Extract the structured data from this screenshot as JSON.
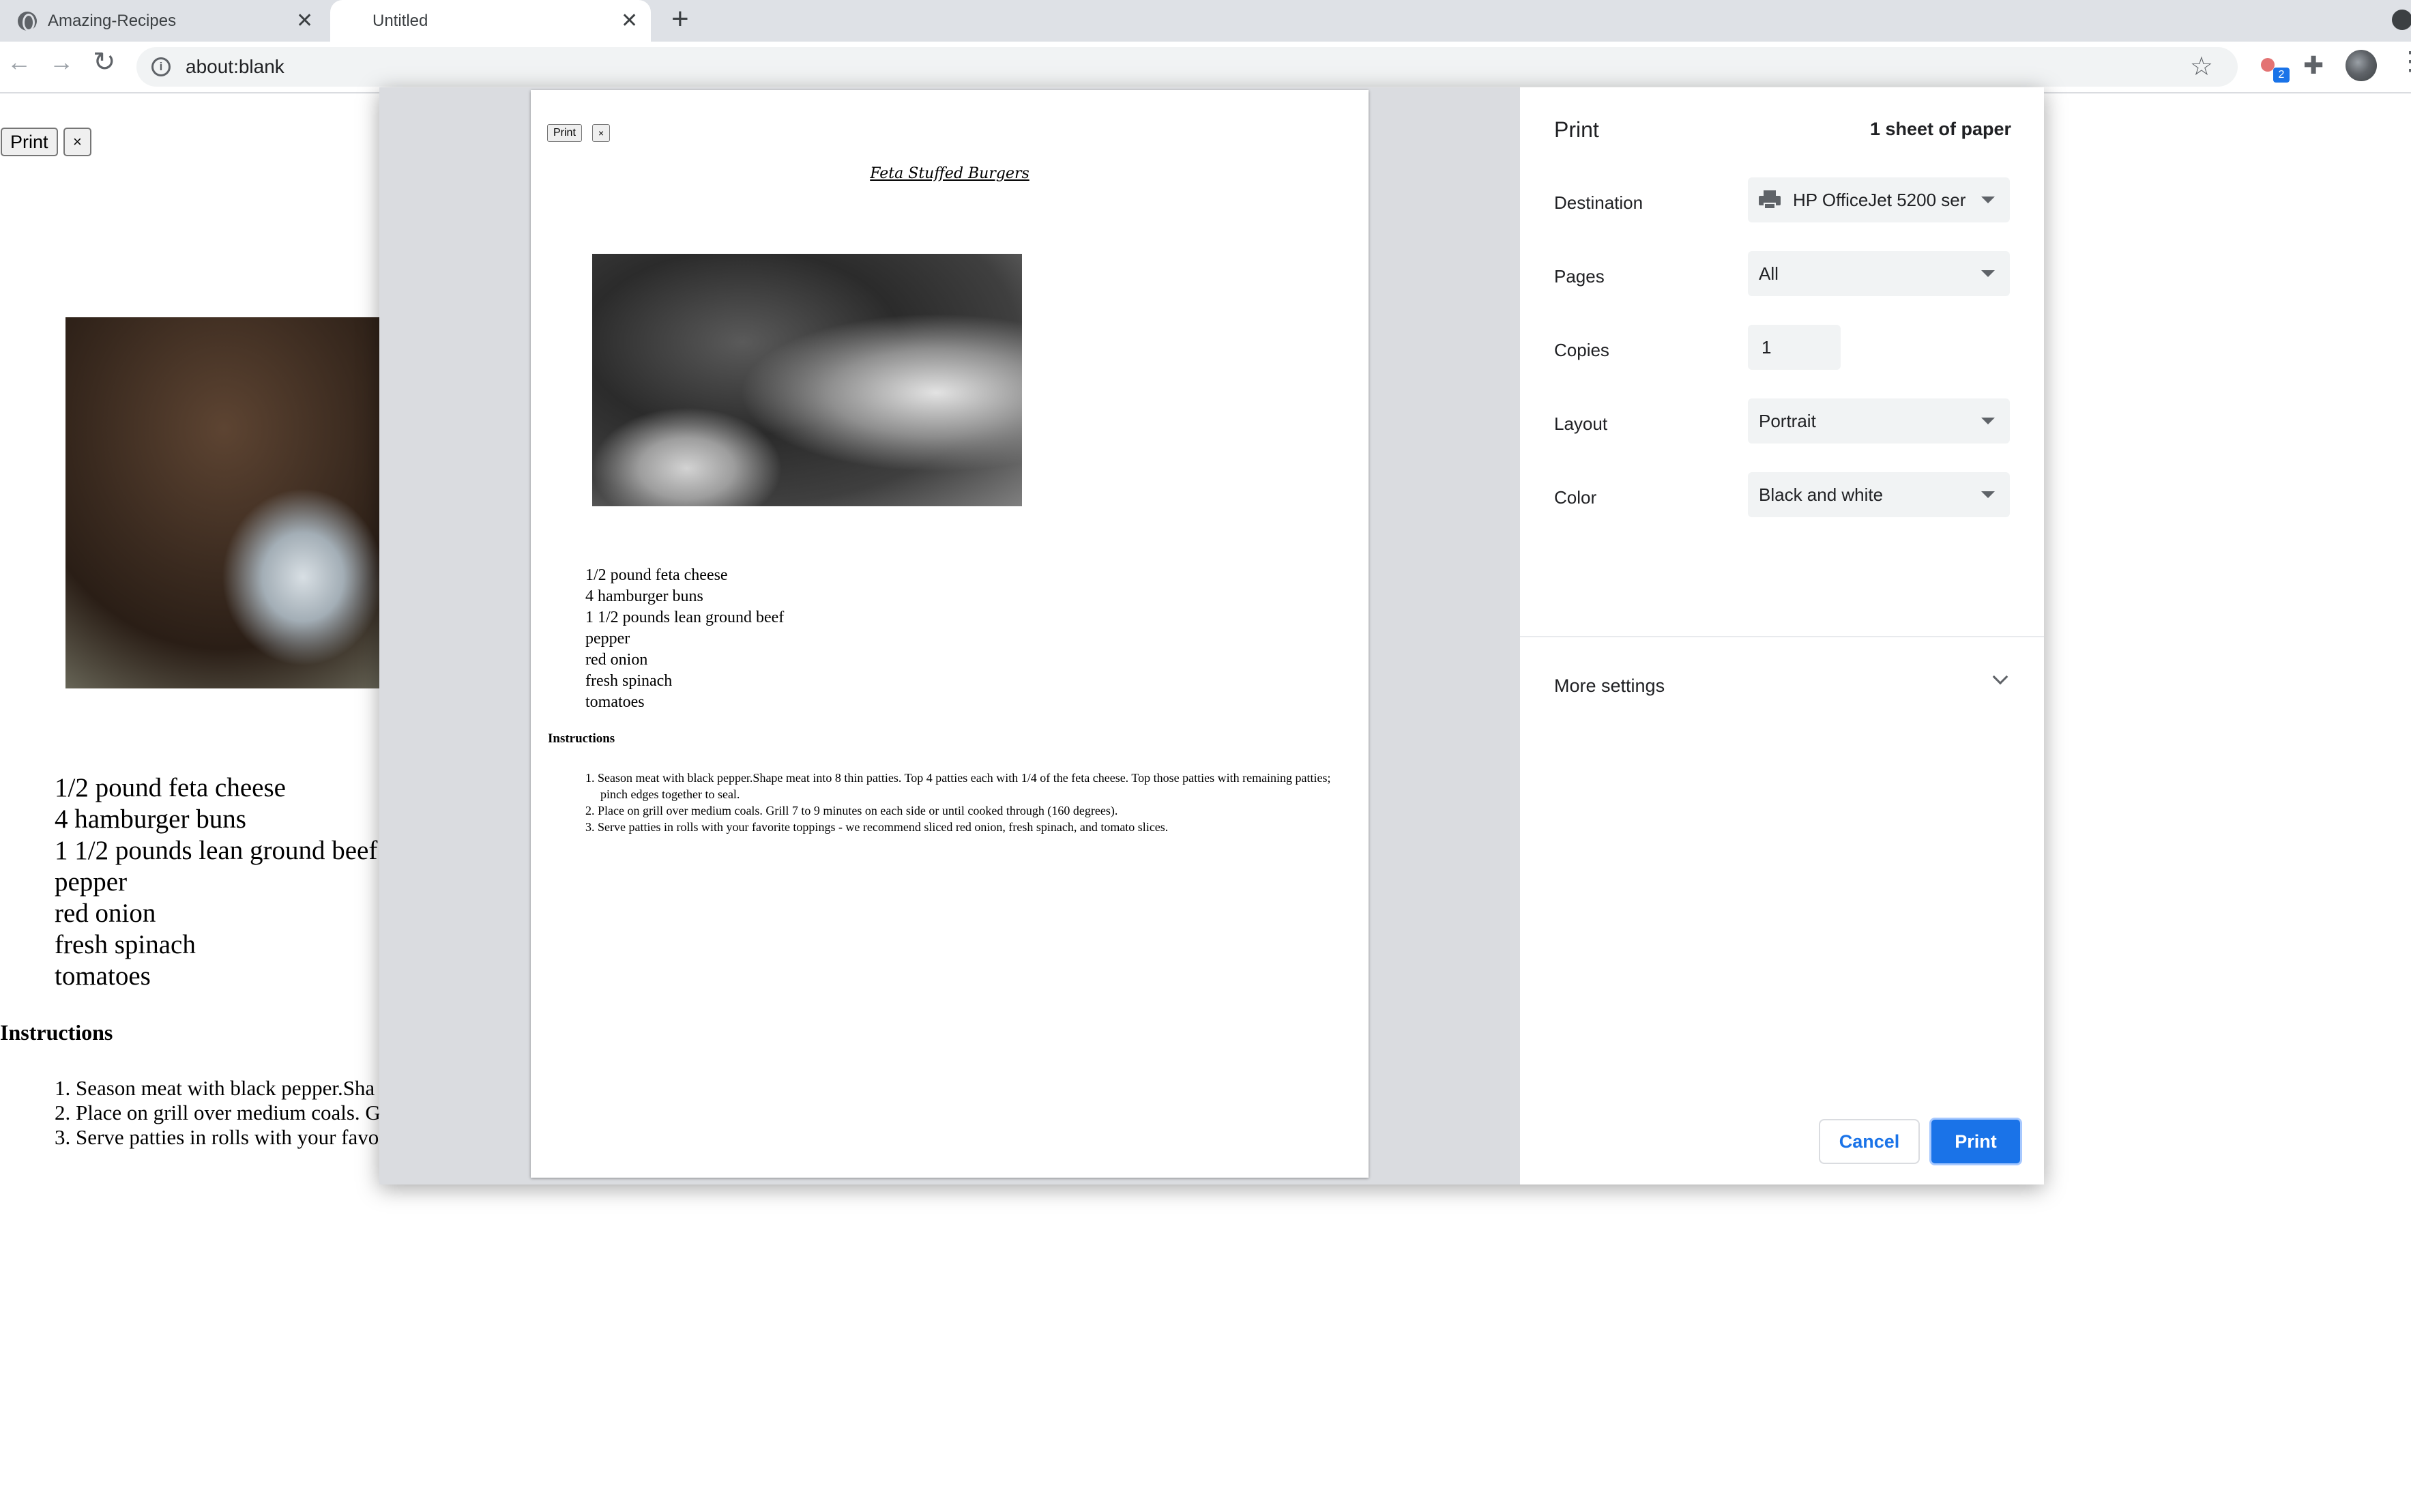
{
  "browser": {
    "tabs": [
      {
        "title": "Amazing-Recipes",
        "active": false
      },
      {
        "title": "Untitled",
        "active": true
      }
    ],
    "new_tab_label": "+",
    "close_glyph": "✕",
    "address": "about:blank",
    "extension_badge": "2",
    "icons": [
      "globe-icon",
      "back-icon",
      "forward-icon",
      "reload-icon",
      "info-icon",
      "star-icon",
      "extension-icon",
      "puzzle-icon",
      "avatar",
      "kebab-menu-icon",
      "tab-search-icon"
    ]
  },
  "page": {
    "print_button": "Print",
    "close_button": "×",
    "ingredients": [
      "1/2 pound feta cheese",
      "4 hamburger buns",
      "1 1/2 pounds lean ground beef",
      "pepper",
      "red onion",
      "fresh spinach",
      "tomatoes"
    ],
    "instructions_heading": "Instructions",
    "steps_visible": [
      "1. Season meat with black pepper.Sha",
      "2. Place on grill over medium coals. G",
      "3. Serve patties in rolls with your favo"
    ]
  },
  "preview": {
    "print_button": "Print",
    "close_button": "×",
    "title": "Feta Stuffed Burgers",
    "ingredients": [
      "1/2 pound feta cheese",
      "4 hamburger buns",
      "1 1/2 pounds lean ground beef",
      "pepper",
      "red onion",
      "fresh spinach",
      "tomatoes"
    ],
    "instructions_heading": "Instructions",
    "steps": [
      "1. Season meat with black pepper.Shape meat into 8 thin patties. Top 4 patties each with 1/4 of the feta cheese. Top those patties with remaining patties; pinch edges together to seal.",
      "2. Place on grill over medium coals. Grill 7 to 9 minutes on each side or until cooked through (160 degrees).",
      "3. Serve patties in rolls with your favorite toppings - we recommend sliced red onion, fresh spinach, and tomato slices."
    ]
  },
  "print_settings": {
    "title": "Print",
    "sheet_count": "1 sheet of paper",
    "destination_label": "Destination",
    "destination_value": "HP OfficeJet 5200 ser",
    "pages_label": "Pages",
    "pages_value": "All",
    "copies_label": "Copies",
    "copies_value": "1",
    "layout_label": "Layout",
    "layout_value": "Portrait",
    "color_label": "Color",
    "color_value": "Black and white",
    "more_settings": "More settings",
    "cancel": "Cancel",
    "print": "Print",
    "accent_color": "#1a73e8"
  }
}
